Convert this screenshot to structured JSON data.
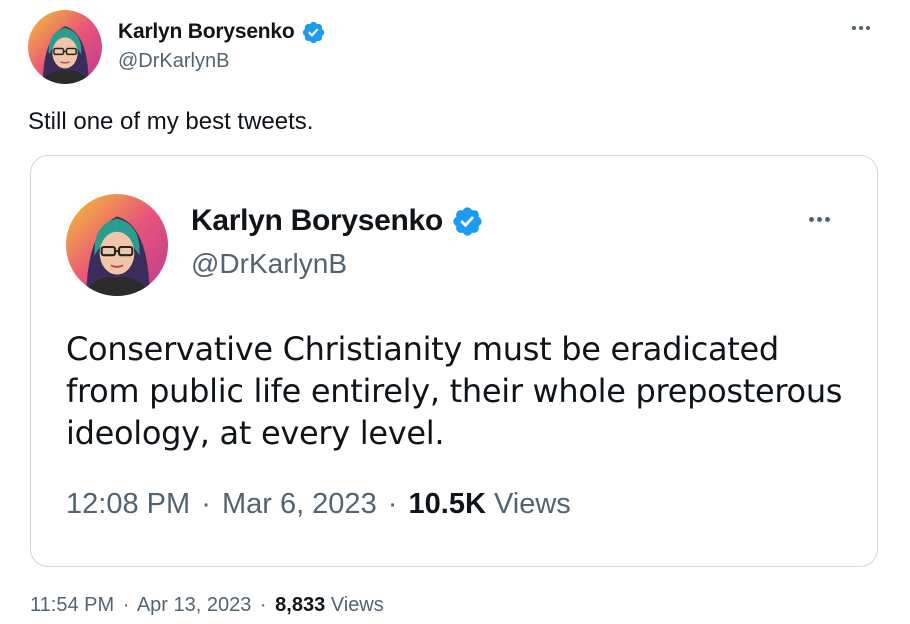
{
  "outer": {
    "author_name": "Karlyn Borysenko",
    "handle": "@DrKarlynB",
    "avatar_icon": "avatar-portrait-icon",
    "verified_icon": "verified-badge-icon",
    "more_icon": "more-options-icon",
    "text": "Still one of my best tweets.",
    "time": "11:54 PM",
    "date": "Apr 13, 2023",
    "views_count": "8,833",
    "views_label": "Views"
  },
  "quoted": {
    "author_name": "Karlyn Borysenko",
    "handle": "@DrKarlynB",
    "text": "Conservative Christianity must be eradicated from public life entirely, their whole preposterous ideology, at every level.",
    "time": "12:08 PM",
    "date": "Mar 6, 2023",
    "views_count": "10.5K",
    "views_label": "Views"
  },
  "separator": "·",
  "colors": {
    "verified_blue": "#1d9bf0",
    "secondary_text": "#536471",
    "primary_text": "#0f1419",
    "card_border": "#cfd9de"
  }
}
